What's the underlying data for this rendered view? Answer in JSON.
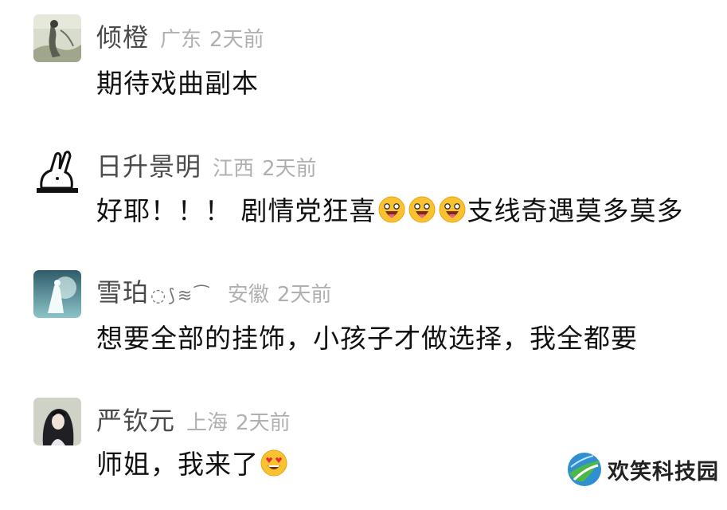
{
  "comments": [
    {
      "username": "倾橙",
      "location": "广东",
      "time": "2天前",
      "text": "期待戏曲副本",
      "avatar_icon": "avatar-ink-painting"
    },
    {
      "username": "日升景明",
      "location": "江西",
      "time": "2天前",
      "text_before": "好耶！！！ 剧情党狂喜",
      "emoji": [
        "😜",
        "😜",
        "😜"
      ],
      "text_after": "支线奇遇莫多莫多",
      "avatar_icon": "avatar-bunny-sketch"
    },
    {
      "username": "雪珀",
      "username_deco": "◌ ⟆ ≋ ⁀",
      "location": "安徽",
      "time": "2天前",
      "text": "想要全部的挂饰，小孩子才做选择，我全都要",
      "avatar_icon": "avatar-moonlight-figure"
    },
    {
      "username": "严钦元",
      "location": "上海",
      "time": "2天前",
      "text_before": "师姐，我来了",
      "emoji": [
        "😍"
      ],
      "avatar_icon": "avatar-dark-hair-character"
    }
  ],
  "watermark": {
    "text": "欢笑科技园",
    "icon": "leaf-globe-logo-icon"
  },
  "colors": {
    "username": "#4a4a4a",
    "meta": "#b0b0b0",
    "text": "#111111",
    "background": "#ffffff"
  }
}
